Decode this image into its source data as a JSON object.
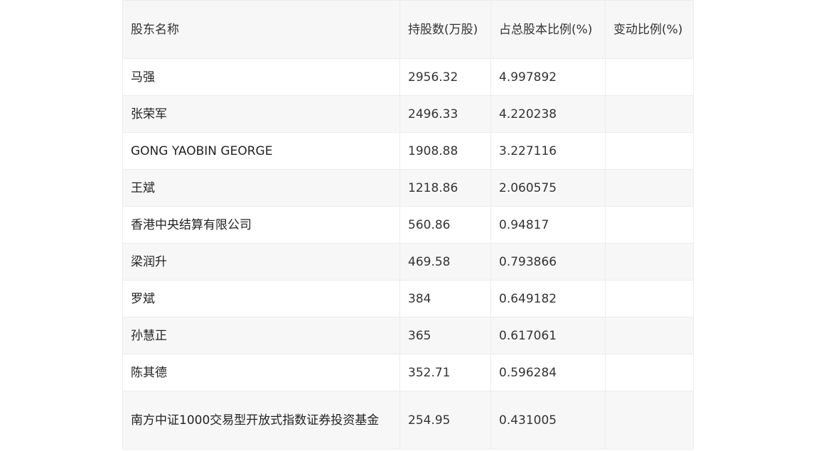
{
  "table": {
    "headers": [
      "股东名称",
      "持股数(万股)",
      "占总股本比例(%)",
      "变动比例(%)"
    ],
    "rows": [
      {
        "name": "马强",
        "shares": "2956.32",
        "ratio": "4.997892",
        "change": ""
      },
      {
        "name": "张荣军",
        "shares": "2496.33",
        "ratio": "4.220238",
        "change": ""
      },
      {
        "name": "GONG YAOBIN GEORGE",
        "shares": "1908.88",
        "ratio": "3.227116",
        "change": ""
      },
      {
        "name": "王斌",
        "shares": "1218.86",
        "ratio": "2.060575",
        "change": ""
      },
      {
        "name": "香港中央结算有限公司",
        "shares": "560.86",
        "ratio": "0.94817",
        "change": ""
      },
      {
        "name": "梁润升",
        "shares": "469.58",
        "ratio": "0.793866",
        "change": ""
      },
      {
        "name": "罗斌",
        "shares": "384",
        "ratio": "0.649182",
        "change": ""
      },
      {
        "name": "孙慧正",
        "shares": "365",
        "ratio": "0.617061",
        "change": ""
      },
      {
        "name": "陈其德",
        "shares": "352.71",
        "ratio": "0.596284",
        "change": ""
      },
      {
        "name": "南方中证1000交易型开放式指数证券投资基金",
        "shares": "254.95",
        "ratio": "0.431005",
        "change": ""
      }
    ]
  }
}
